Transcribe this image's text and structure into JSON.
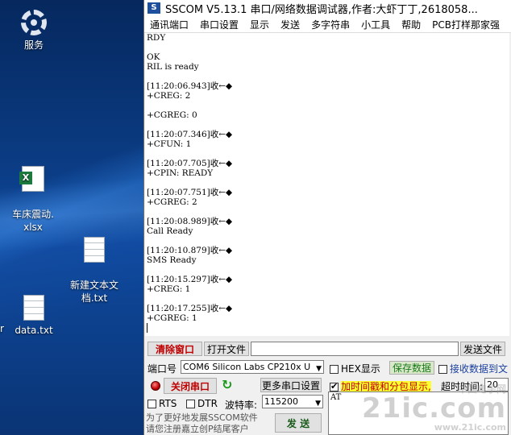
{
  "desktop": {
    "icons": [
      {
        "label": "服务",
        "icon": "gear-icon"
      },
      {
        "label": "车床震动.\nxlsx",
        "icon": "excel-file-icon"
      },
      {
        "label": "新建文本文\n档.txt",
        "icon": "text-file-icon"
      },
      {
        "label": "data.txt",
        "icon": "text-file-icon"
      }
    ],
    "edge_label": "r"
  },
  "window": {
    "title": "SSCOM V5.13.1 串口/网络数据调试器,作者:大虾丁丁,2618058...",
    "menu": [
      "通讯端口",
      "串口设置",
      "显示",
      "发送",
      "多字符串",
      "小工具",
      "帮助",
      "PCB打样那家强"
    ]
  },
  "output_lines": [
    "RDY",
    "",
    "OK",
    "RIL is ready",
    "",
    "[11:20:06.943]收←◆",
    "+CREG: 2",
    "",
    "+CGREG: 0",
    "",
    "[11:20:07.346]收←◆",
    "+CFUN: 1",
    "",
    "[11:20:07.705]收←◆",
    "+CPIN: READY",
    "",
    "[11:20:07.751]收←◆",
    "+CGREG: 2",
    "",
    "[11:20:08.989]收←◆",
    "Call Ready",
    "",
    "[11:20:10.879]收←◆",
    "SMS Ready",
    "",
    "[11:20:15.297]收←◆",
    "+CREG: 1",
    "",
    "[11:20:17.255]收←◆",
    "+CGREG: 1"
  ],
  "controls": {
    "clear_window": "清除窗口",
    "open_file": "打开文件",
    "file_path": "",
    "send_file": "发送文件",
    "port_label": "端口号",
    "port_value": "COM6 Silicon Labs CP210x U",
    "hex_display": "HEX显示",
    "save_data": "保存数据",
    "receive_to_file": "接收数据到文",
    "close_port": "关闭串口",
    "more_settings": "更多串口设置",
    "timestamp_label": "加时间戳和分包显示,",
    "timeout_label": "超时时间:",
    "timeout_value": "20",
    "rts": "RTS",
    "dtr": "DTR",
    "baud_label": "波特率:",
    "baud_value": "115200",
    "send_text": "AT",
    "send_button": "发 送",
    "promo_line1": "为了更好地发展SSCOM软件",
    "promo_line2": "请您注册嘉立创P结尾客户"
  },
  "state": {
    "hex_display_checked": false,
    "receive_to_file_checked": false,
    "timestamp_checked": true,
    "rts_checked": false,
    "dtr_checked": false
  },
  "watermark": {
    "big": "21ic.com",
    "small": "中国电子网",
    "url": "www.21ic.com"
  }
}
